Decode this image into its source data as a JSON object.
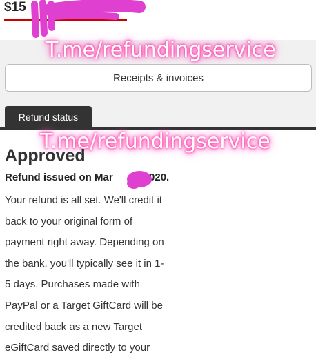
{
  "order": {
    "price_visible": "$15"
  },
  "watermark": {
    "text": "T.me/refundingservice"
  },
  "receipts_button": {
    "label": "Receipts & invoices"
  },
  "tab": {
    "label": "Refund status"
  },
  "status": {
    "heading": "Approved",
    "issued_prefix": "Refund issued on Mar",
    "issued_suffix": "020.",
    "body_lines": [
      "Your refund is all set. We'll credit it",
      "back to your original form of",
      "payment right away. Depending on",
      "the bank, you'll typically see it in 1-",
      "5 days. Purchases made with",
      "PayPal or a Target GiftCard will be",
      "credited back as a new Target",
      "eGiftCard saved directly to your"
    ]
  },
  "colors": {
    "accent_red": "#cc0000",
    "tab_dark": "#333333",
    "redaction_magenta": "#e040d0"
  }
}
